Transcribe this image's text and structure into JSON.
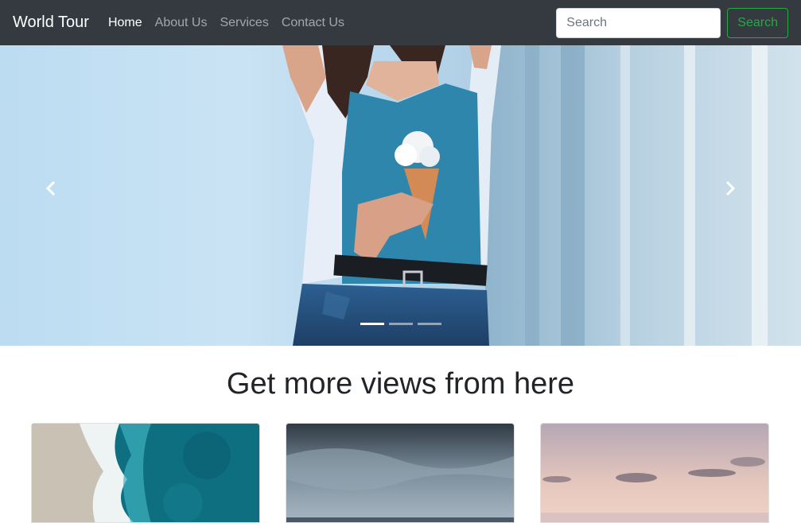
{
  "navbar": {
    "brand": "World Tour",
    "links": [
      "Home",
      "About Us",
      "Services",
      "Contact Us"
    ],
    "active_link": "Home",
    "search": {
      "placeholder": "Search",
      "value": ""
    },
    "search_button": "Search",
    "accent_color": "#28a745"
  },
  "carousel": {
    "prev_icon": "chevron-left-icon",
    "next_icon": "chevron-right-icon",
    "indicator_count": 3,
    "active_index": 0
  },
  "section": {
    "title": "Get more views from here"
  },
  "cards": [
    {
      "image": "ocean-shore-aerial"
    },
    {
      "image": "stormy-sea"
    },
    {
      "image": "sunset-sea"
    }
  ]
}
